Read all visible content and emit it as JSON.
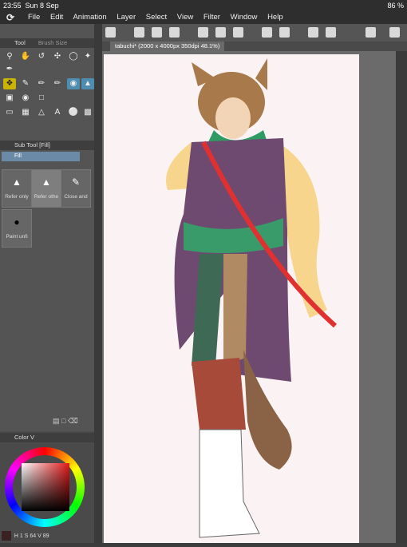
{
  "status": {
    "time": "23:55",
    "date": "Sun 8 Sep",
    "battery": "86 %"
  },
  "menu": {
    "items": [
      "File",
      "Edit",
      "Animation",
      "Layer",
      "Select",
      "View",
      "Filter",
      "Window",
      "Help"
    ]
  },
  "document": {
    "tab_title": "tabuchi* (2000 x 4000px 350dpi 48.1%)"
  },
  "tool_panel": {
    "title": "Tool",
    "second_tab": "Brush Size"
  },
  "sub_tool_panel": {
    "title": "Sub Tool [Fill]",
    "group": "Fill",
    "items": [
      "Refer only",
      "Refer othe",
      "Close and"
    ],
    "item2": "Paint unfi"
  },
  "color_panel": {
    "title": "Color V",
    "h": "1",
    "s": "64",
    "v": "89"
  }
}
